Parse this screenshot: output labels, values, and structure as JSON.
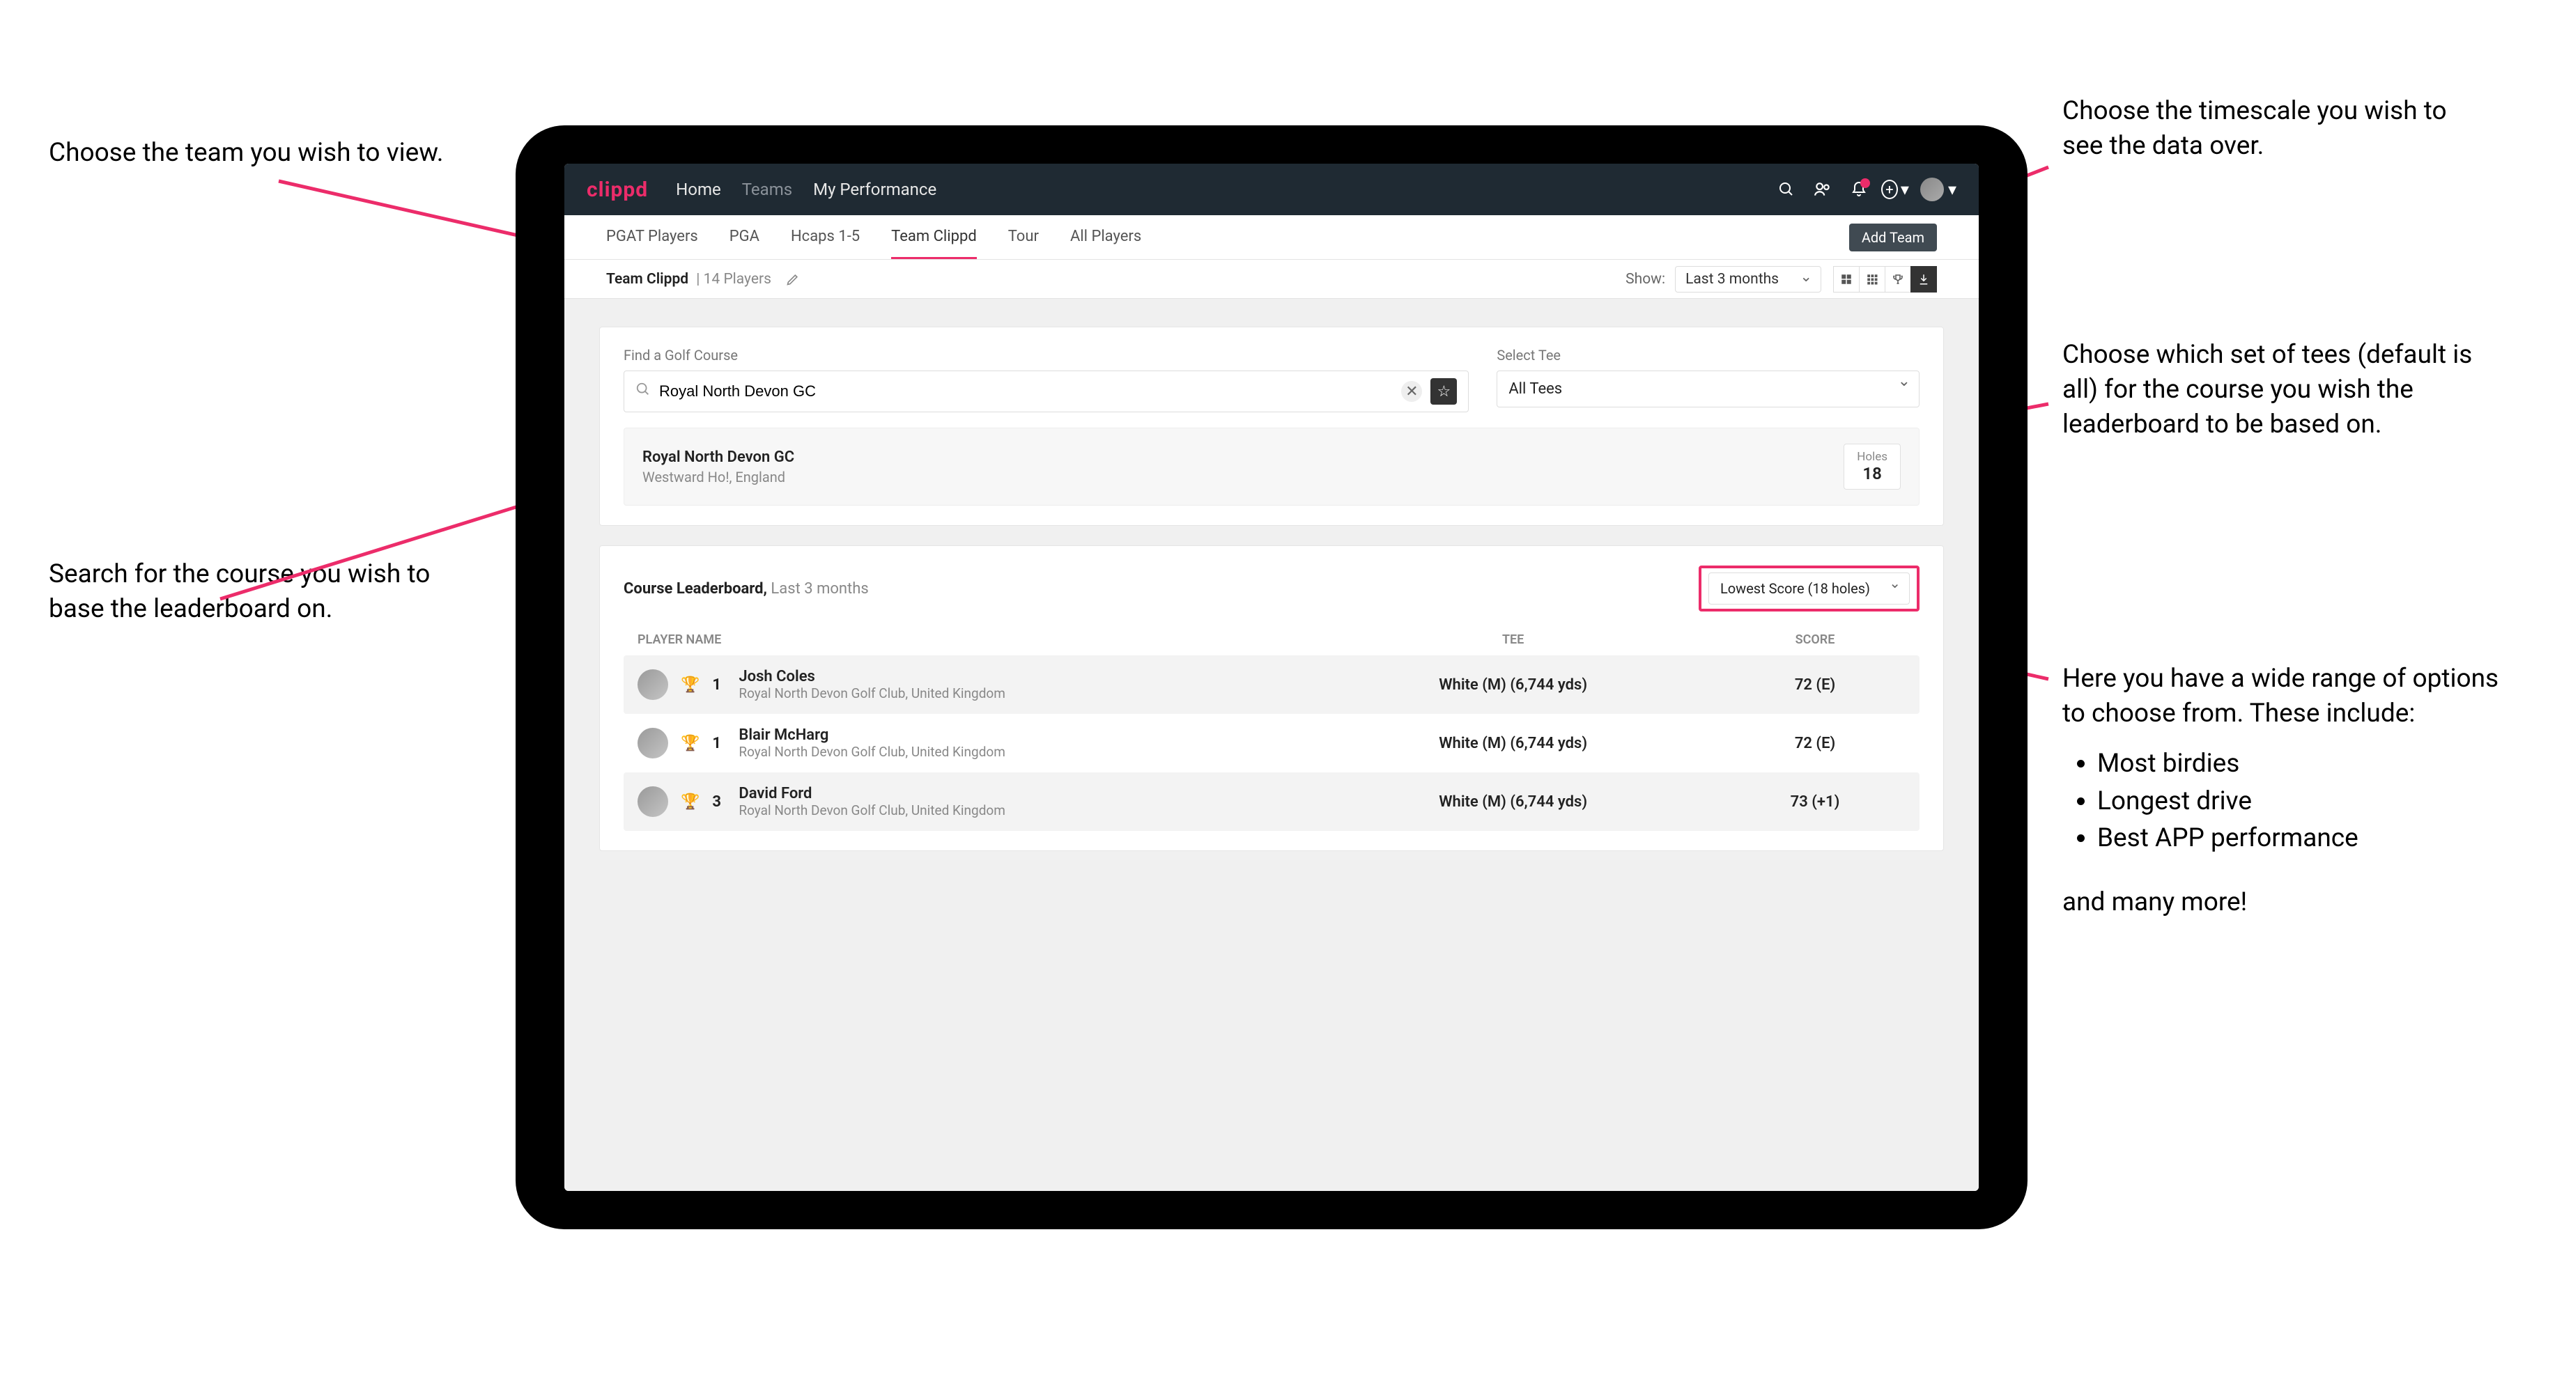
{
  "annotations": {
    "team": "Choose the team you wish to view.",
    "timescale": "Choose the timescale you wish to see the data over.",
    "tees": "Choose which set of tees (default is all) for the course you wish the leaderboard to be based on.",
    "search": "Search for the course you wish to base the leaderboard on.",
    "options_intro": "Here you have a wide range of options to choose from. These include:",
    "options": [
      "Most birdies",
      "Longest drive",
      "Best APP performance"
    ],
    "options_more": "and many more!"
  },
  "brand": "clippd",
  "topnav": {
    "items": [
      "Home",
      "Teams",
      "My Performance"
    ],
    "active": 1
  },
  "subtabs": {
    "items": [
      "PGAT Players",
      "PGA",
      "Hcaps 1-5",
      "Team Clippd",
      "Tour",
      "All Players"
    ],
    "active": 3,
    "add_team": "Add Team"
  },
  "teambar": {
    "name": "Team Clippd",
    "count_label": "14 Players",
    "show_label": "Show:",
    "timescale": "Last 3 months"
  },
  "search": {
    "find_label": "Find a Golf Course",
    "value": "Royal North Devon GC",
    "tee_label": "Select Tee",
    "tee_value": "All Tees"
  },
  "course": {
    "name": "Royal North Devon GC",
    "location": "Westward Ho!, England",
    "holes_label": "Holes",
    "holes": "18"
  },
  "leaderboard": {
    "title": "Course Leaderboard,",
    "period": "Last 3 months",
    "score_type": "Lowest Score (18 holes)",
    "columns": {
      "player": "PLAYER NAME",
      "tee": "TEE",
      "score": "SCORE"
    },
    "rows": [
      {
        "rank": "1",
        "name": "Josh Coles",
        "club": "Royal North Devon Golf Club, United Kingdom",
        "tee": "White (M) (6,744 yds)",
        "score": "72 (E)"
      },
      {
        "rank": "1",
        "name": "Blair McHarg",
        "club": "Royal North Devon Golf Club, United Kingdom",
        "tee": "White (M) (6,744 yds)",
        "score": "72 (E)"
      },
      {
        "rank": "3",
        "name": "David Ford",
        "club": "Royal North Devon Golf Club, United Kingdom",
        "tee": "White (M) (6,744 yds)",
        "score": "73 (+1)"
      }
    ]
  }
}
